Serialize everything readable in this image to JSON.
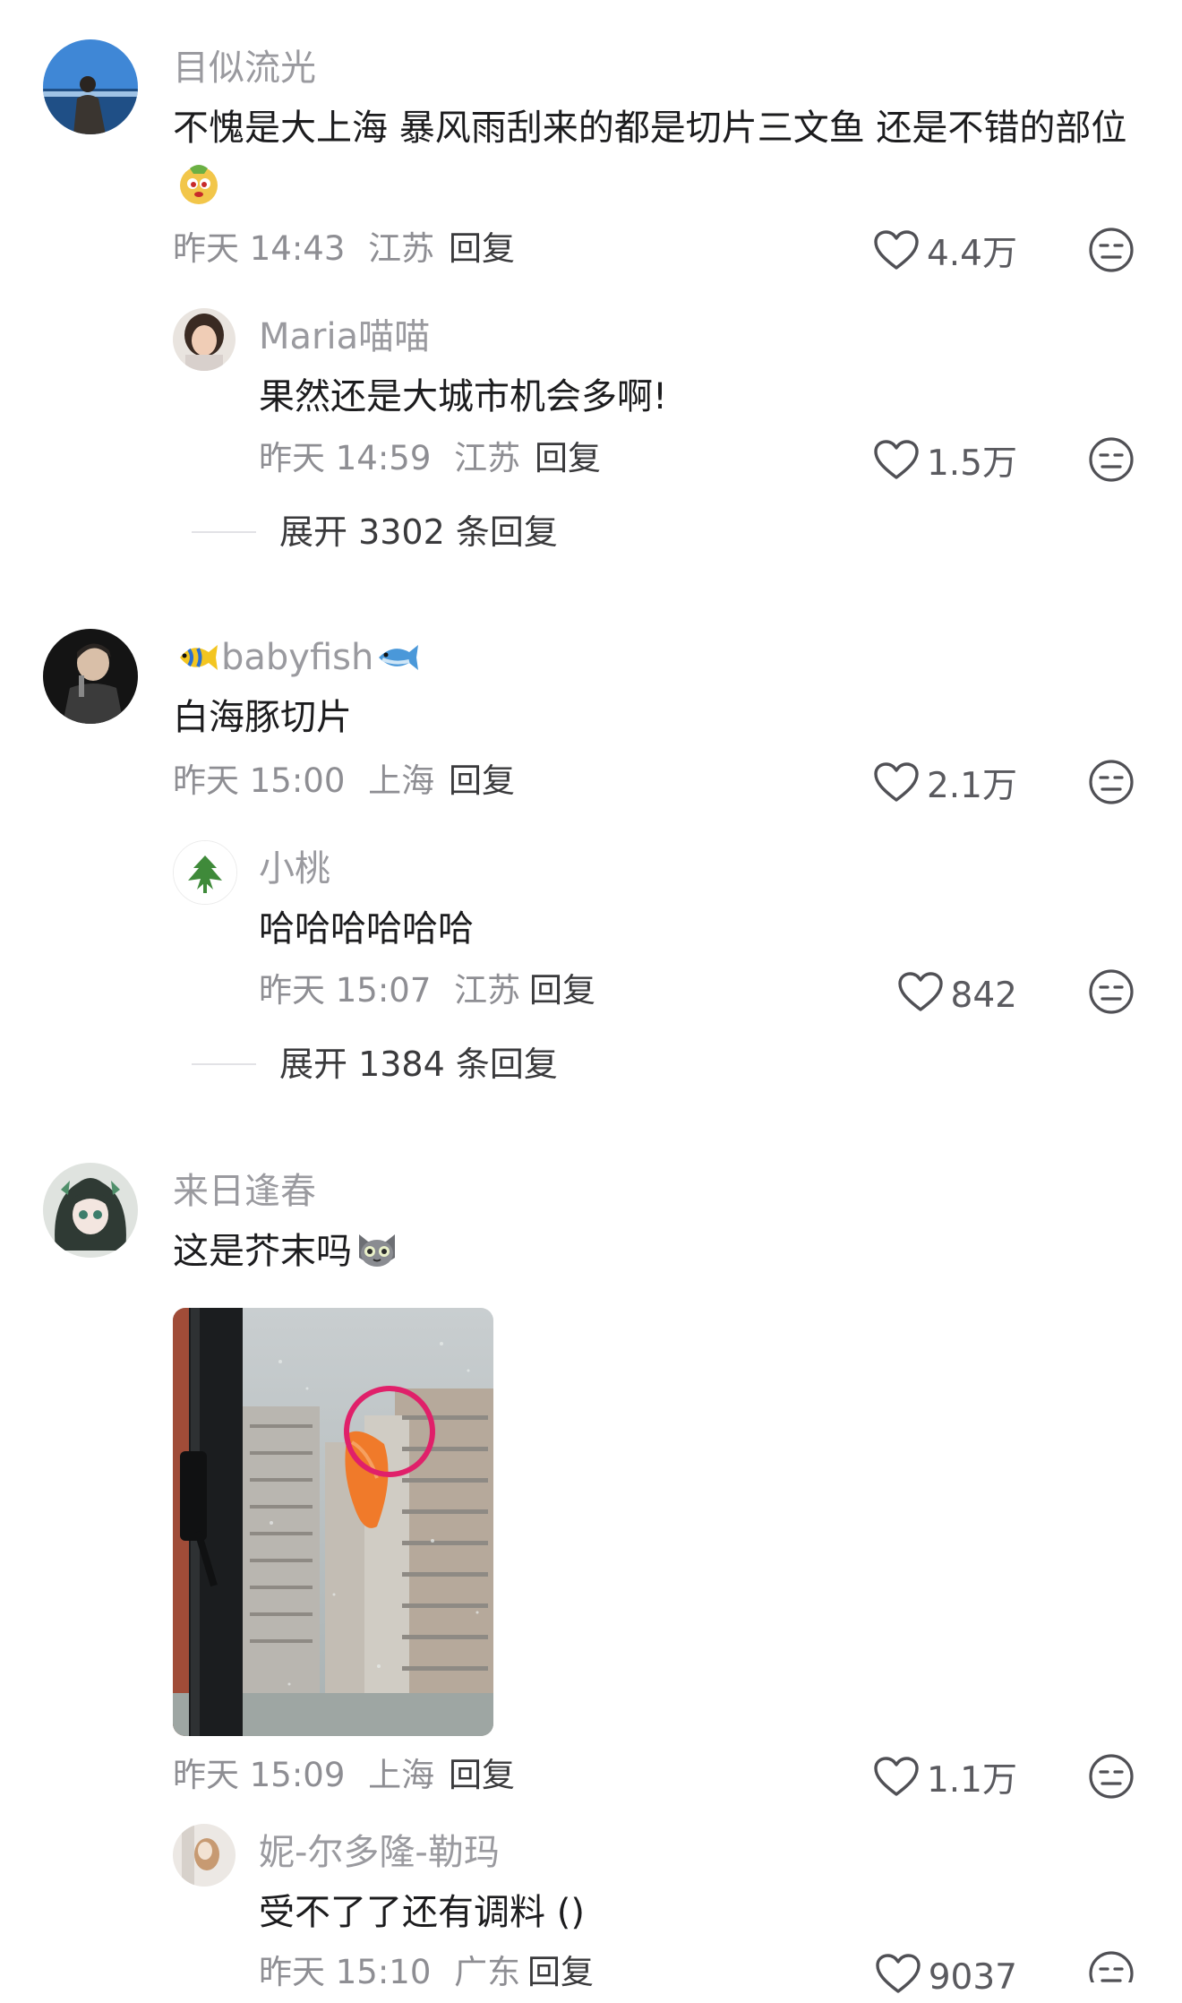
{
  "comments": [
    {
      "username": "目似流光",
      "text": "不愧是大上海 暴风雨刮来的都是切片三文鱼 还是不错的部位",
      "date": "昨天 14:43",
      "location": "江苏",
      "reply_label": "回复",
      "likes": "4.4万",
      "reply": {
        "username": "Maria喵喵",
        "text": "果然还是大城市机会多啊!",
        "date": "昨天 14:59",
        "location": "江苏",
        "reply_label": "回复",
        "likes": "1.5万"
      },
      "expand_label": "展开 3302 条回复"
    },
    {
      "username": "babyfish",
      "text": "白海豚切片",
      "date": "昨天 15:00",
      "location": "上海",
      "reply_label": "回复",
      "likes": "2.1万",
      "reply": {
        "username": "小桃",
        "text": "哈哈哈哈哈哈",
        "date": "昨天 15:07",
        "location": "江苏",
        "reply_label": "回复",
        "likes": "842"
      },
      "expand_label": "展开 1384 条回复"
    },
    {
      "username": "来日逢春",
      "text": "这是芥末吗",
      "date": "昨天 15:09",
      "location": "上海",
      "reply_label": "回复",
      "likes": "1.1万",
      "reply": {
        "username": "妮-尔多隆-勒玛",
        "text": "受不了了还有调料 ()",
        "date": "昨天 15:10",
        "location": "广东",
        "reply_label": "回复",
        "likes": "9037"
      }
    }
  ],
  "icons": {
    "like": "heart-outline-icon",
    "emoji_reaction": "meh-face-icon"
  },
  "colors": {
    "username": "#9a9a9f",
    "text": "#1c1c1e",
    "meta": "#8e8e93",
    "salmon": "#f07a2a",
    "circle_annotation": "#e0206a"
  }
}
